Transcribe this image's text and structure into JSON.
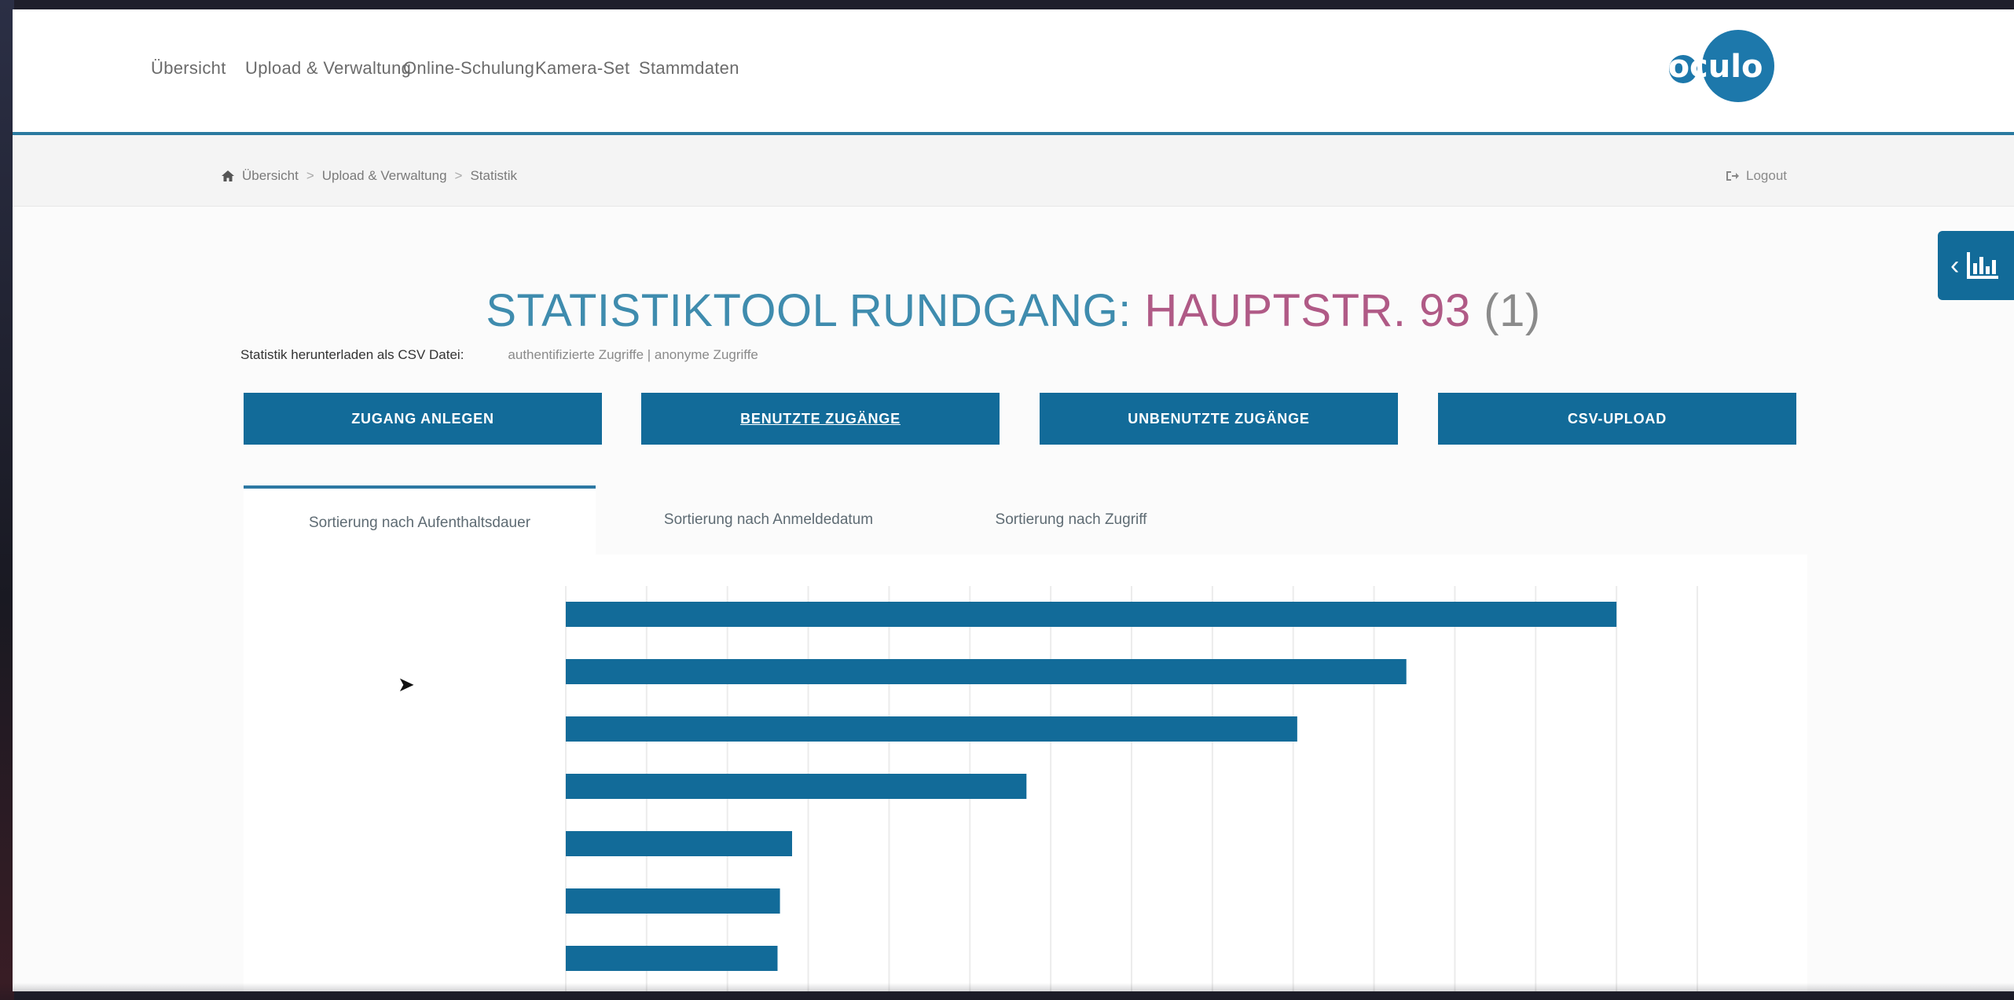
{
  "nav": {
    "items": [
      "Übersicht",
      "Upload & Verwaltung",
      "Online-Schulung",
      "Kamera-Set",
      "Stammdaten"
    ],
    "logo_text": "oculo"
  },
  "breadcrumb": {
    "items": [
      "Übersicht",
      "Upload & Verwaltung",
      "Statistik"
    ],
    "separator": ">"
  },
  "logout_label": "Logout",
  "title": {
    "part1": "STATISTIKTOOL RUNDGANG: ",
    "part2": "HAUPTSTR. 93",
    "part3": " (1)"
  },
  "download": {
    "label": "Statistik herunterladen als CSV Datei:",
    "links": "authentifizierte Zugriffe | anonyme Zugriffe"
  },
  "buttons": [
    "ZUGANG ANLEGEN",
    "BENUTZTE ZUGÄNGE",
    "UNBENUTZTE ZUGÄNGE",
    "CSV-UPLOAD"
  ],
  "tabs": [
    "Sortierung nach Aufenthaltsdauer",
    "Sortierung nach Anmeldedatum",
    "Sortierung nach Zugriff"
  ],
  "colors": {
    "primary": "#126b99",
    "title_blue": "#3f8cae",
    "title_pink": "#b05a86"
  },
  "chart_data": {
    "type": "bar",
    "orientation": "horizontal",
    "categories": [
      "",
      "",
      "",
      "",
      "",
      "",
      ""
    ],
    "values": [
      13,
      10.4,
      9.05,
      5.7,
      2.8,
      2.65,
      2.62
    ],
    "xlim": [
      0,
      14
    ],
    "grid": true,
    "color": "#126b99"
  }
}
